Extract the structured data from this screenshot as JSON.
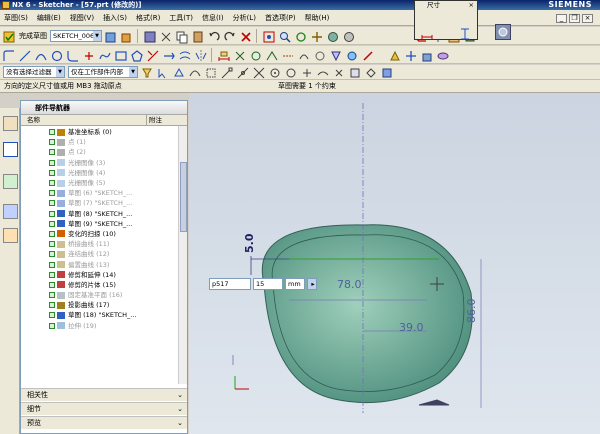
{
  "window": {
    "title": "NX 6 - Sketcher - [57.prt (修改的)]",
    "brand": "SIEMENS"
  },
  "menu": [
    "草图(S)",
    "编辑(E)",
    "视图(V)",
    "插入(S)",
    "格式(R)",
    "工具(T)",
    "信息(I)",
    "分析(L)",
    "首选项(P)",
    "帮助(H)"
  ],
  "sketch_toolbar": {
    "finish_label": "完成草图",
    "sketch_name": "SKETCH_006"
  },
  "filters": {
    "selection_filter": "没有选择过滤器",
    "scope": "仅在工作部件内部"
  },
  "status": {
    "left": "方向的定义尺寸值或用 MB3 拖动原点",
    "right": "草图需要 1 个约束"
  },
  "dim_dialog": {
    "title": "尺寸"
  },
  "nav": {
    "title": "部件导航器",
    "col_name": "名称",
    "col_rel": "附注",
    "items": [
      {
        "label": "基准坐标系 (0)",
        "grey": false,
        "icon": "csys"
      },
      {
        "label": "点 (1)",
        "grey": true,
        "icon": "point"
      },
      {
        "label": "点 (2)",
        "grey": true,
        "icon": "point"
      },
      {
        "label": "光栅图像 (3)",
        "grey": true,
        "icon": "image"
      },
      {
        "label": "光栅图像 (4)",
        "grey": true,
        "icon": "image"
      },
      {
        "label": "光栅图像 (5)",
        "grey": true,
        "icon": "image"
      },
      {
        "label": "草图 (6) \"SKETCH_...",
        "grey": true,
        "icon": "sketch"
      },
      {
        "label": "草图 (7) \"SKETCH_...",
        "grey": true,
        "icon": "sketch"
      },
      {
        "label": "草图 (8) \"SKETCH_...",
        "grey": false,
        "icon": "sketch"
      },
      {
        "label": "草图 (9) \"SKETCH_...",
        "grey": false,
        "icon": "sketch"
      },
      {
        "label": "变化的扫掠 (10)",
        "grey": false,
        "icon": "sweep"
      },
      {
        "label": "桥接曲线 (11)",
        "grey": true,
        "icon": "curve"
      },
      {
        "label": "连结曲线 (12)",
        "grey": true,
        "icon": "curve"
      },
      {
        "label": "偏置曲线 (13)",
        "grey": true,
        "icon": "curve"
      },
      {
        "label": "修剪和延伸 (14)",
        "grey": false,
        "icon": "trim"
      },
      {
        "label": "修剪的片体 (15)",
        "grey": false,
        "icon": "trim"
      },
      {
        "label": "固定基准平面 (16)",
        "grey": true,
        "icon": "plane"
      },
      {
        "label": "投影曲线 (17)",
        "grey": false,
        "icon": "curve"
      },
      {
        "label": "草图 (18) \"SKETCH_...",
        "grey": false,
        "icon": "sketch"
      },
      {
        "label": "拉伸 (19)",
        "grey": true,
        "icon": "extrude"
      }
    ],
    "footers": [
      "相关性",
      "细节",
      "预览"
    ]
  },
  "input": {
    "expr": "p517",
    "value": "15",
    "unit": "mm"
  },
  "dims": {
    "d1": "5.0",
    "d2": "78.0",
    "d3": "39.0",
    "d4": "86.0"
  }
}
